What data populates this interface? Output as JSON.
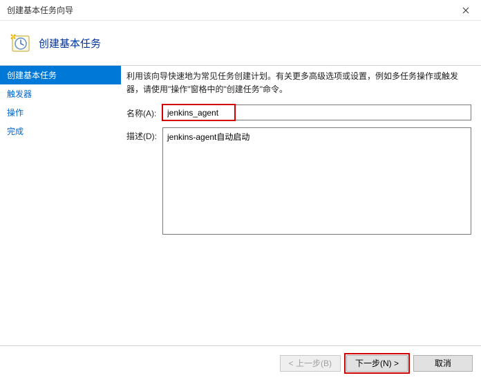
{
  "window": {
    "title": "创建基本任务向导"
  },
  "header": {
    "title": "创建基本任务"
  },
  "sidebar": {
    "items": [
      {
        "label": "创建基本任务",
        "selected": true
      },
      {
        "label": "触发器",
        "selected": false
      },
      {
        "label": "操作",
        "selected": false
      },
      {
        "label": "完成",
        "selected": false
      }
    ]
  },
  "content": {
    "instruction": "利用该向导快速地为常见任务创建计划。有关更多高级选项或设置，例如多任务操作或触发器，请使用\"操作\"窗格中的\"创建任务\"命令。",
    "name_label": "名称(A):",
    "name_value": "jenkins_agent",
    "desc_label": "描述(D):",
    "desc_value": "jenkins-agent自动启动"
  },
  "footer": {
    "back": "< 上一步(B)",
    "next": "下一步(N) >",
    "cancel": "取消"
  }
}
